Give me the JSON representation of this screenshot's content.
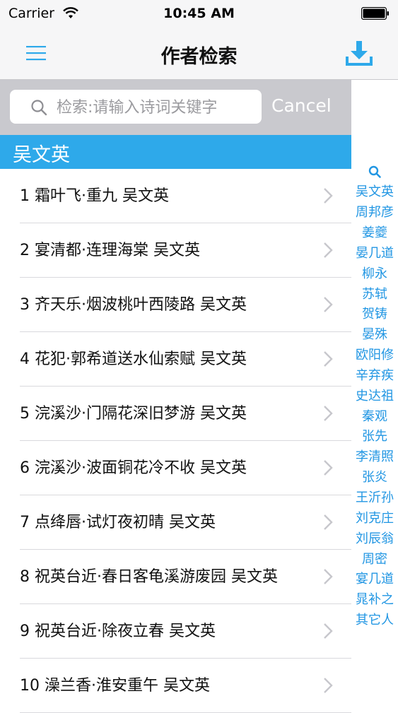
{
  "status": {
    "carrier": "Carrier",
    "time": "10:45 AM"
  },
  "nav": {
    "title": "作者检索",
    "menu_icon": "hamburger-menu-icon",
    "download_icon": "download-icon"
  },
  "search": {
    "placeholder": "检索:请输入诗词关键字",
    "value": "",
    "cancel_label": "Cancel"
  },
  "section": {
    "header": "吴文英"
  },
  "rows": [
    {
      "title": "1 霜叶飞·重九  吴文英"
    },
    {
      "title": "2 宴清都·连理海棠  吴文英"
    },
    {
      "title": "3 齐天乐·烟波桃叶西陵路  吴文英"
    },
    {
      "title": "4 花犯·郭希道送水仙索赋  吴文英"
    },
    {
      "title": "5 浣溪沙·门隔花深旧梦游  吴文英"
    },
    {
      "title": "6 浣溪沙·波面铜花冷不收  吴文英"
    },
    {
      "title": "7 点绛唇·试灯夜初晴  吴文英"
    },
    {
      "title": "8 祝英台近·春日客龟溪游废园  吴文英"
    },
    {
      "title": "9 祝英台近·除夜立春  吴文英"
    },
    {
      "title": "10 澡兰香·淮安重午  吴文英"
    }
  ],
  "index": [
    "吴文英",
    "周邦彦",
    "姜夔",
    "晏几道",
    "柳永",
    "苏轼",
    "贺铸",
    "晏殊",
    "欧阳修",
    "辛弃疾",
    "史达祖",
    "秦观",
    "张先",
    "李清照",
    "张炎",
    "王沂孙",
    "刘克庄",
    "刘辰翁",
    "周密",
    "宴几道",
    "晁补之",
    "其它人"
  ],
  "colors": {
    "accent": "#2ea9ea",
    "index_text": "#2196e3",
    "search_bg": "#c9c9ce"
  }
}
